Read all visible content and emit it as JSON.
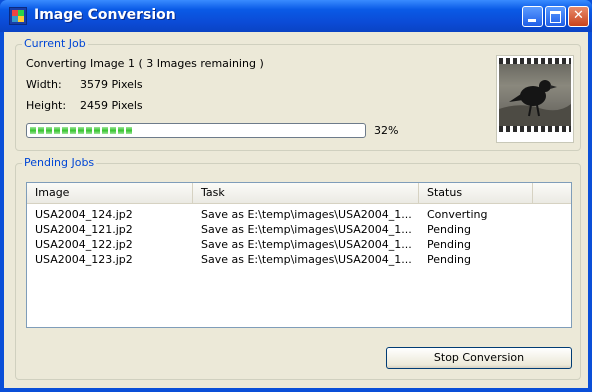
{
  "window": {
    "title": "Image Conversion",
    "controls": [
      "minimize",
      "maximize",
      "close"
    ]
  },
  "current_job": {
    "group_label": "Current Job",
    "status": "Converting Image 1 ( 3 Images remaining )",
    "width_label": "Width:",
    "width_value": "3579 Pixels",
    "height_label": "Height:",
    "height_value": "2459 Pixels",
    "progress_percent": 32,
    "progress_text": "32%",
    "thumbnail": "bird-photo"
  },
  "pending_jobs": {
    "group_label": "Pending Jobs",
    "columns": [
      "Image",
      "Task",
      "Status"
    ],
    "rows": [
      {
        "image": "USA2004_124.jp2",
        "task": "Save as E:\\temp\\images\\USA2004_1...",
        "status": "Converting"
      },
      {
        "image": "USA2004_121.jp2",
        "task": "Save as E:\\temp\\images\\USA2004_1...",
        "status": "Pending"
      },
      {
        "image": "USA2004_122.jp2",
        "task": "Save as E:\\temp\\images\\USA2004_1...",
        "status": "Pending"
      },
      {
        "image": "USA2004_123.jp2",
        "task": "Save as E:\\temp\\images\\USA2004_1...",
        "status": "Pending"
      }
    ]
  },
  "actions": {
    "stop_label": "Stop Conversion"
  },
  "colors": {
    "titlebar": "#0a5ae6",
    "group_label": "#0046d5",
    "progress_fill": "#37c32e",
    "dialog_bg": "#ece9d8"
  }
}
